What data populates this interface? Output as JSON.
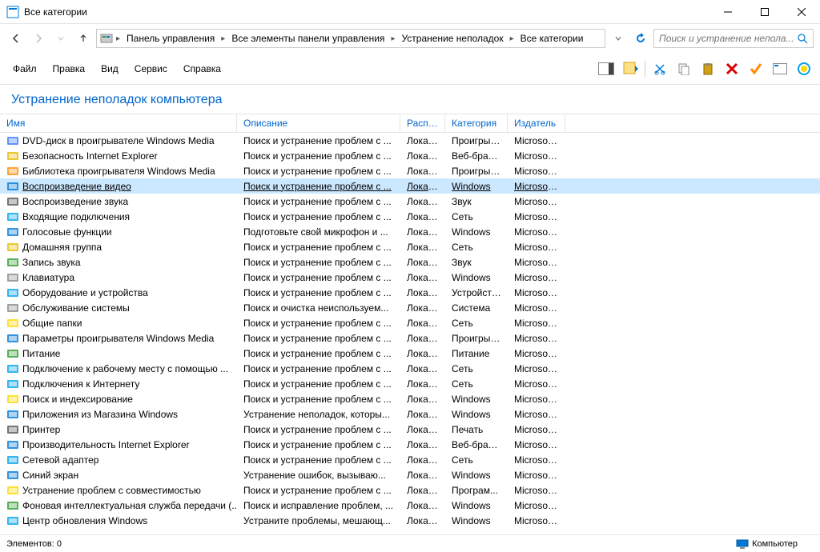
{
  "window": {
    "title": "Все категории",
    "minimize": "—",
    "maximize": "☐",
    "close": "✕"
  },
  "breadcrumb": {
    "items": [
      "Панель управления",
      "Все элементы панели управления",
      "Устранение неполадок",
      "Все категории"
    ]
  },
  "search": {
    "placeholder": "Поиск и устранение непола..."
  },
  "menu": {
    "items": [
      "Файл",
      "Правка",
      "Вид",
      "Сервис",
      "Справка"
    ]
  },
  "heading": "Устранение неполадок компьютера",
  "columns": {
    "name": "Имя",
    "desc": "Описание",
    "loc": "Распо...",
    "cat": "Категория",
    "pub": "Издатель"
  },
  "rows": [
    {
      "name": "DVD-диск в проигрывателе Windows Media",
      "desc": "Поиск и устранение проблем с ...",
      "loc": "Локал...",
      "cat": "Проигрыв...",
      "pub": "Microsoft ...",
      "icon": "#3b78ff"
    },
    {
      "name": "Безопасность Internet Explorer",
      "desc": "Поиск и устранение проблем с ...",
      "loc": "Локал...",
      "cat": "Веб-брауз...",
      "pub": "Microsoft ...",
      "icon": "#e7b900"
    },
    {
      "name": "Библиотека проигрывателя Windows Media",
      "desc": "Поиск и устранение проблем с ...",
      "loc": "Локал...",
      "cat": "Проигрыв...",
      "pub": "Microsoft ...",
      "icon": "#ff8c00"
    },
    {
      "name": "Воспроизведение видео",
      "desc": "Поиск и устранение проблем с ...",
      "loc": "Локал...",
      "cat": "Windows",
      "pub": "Microsoft ...",
      "icon": "#0078d7",
      "selected": true
    },
    {
      "name": "Воспроизведение звука",
      "desc": "Поиск и устранение проблем с ...",
      "loc": "Локал...",
      "cat": "Звук",
      "pub": "Microsoft ...",
      "icon": "#555"
    },
    {
      "name": "Входящие подключения",
      "desc": "Поиск и устранение проблем с ...",
      "loc": "Локал...",
      "cat": "Сеть",
      "pub": "Microsoft ...",
      "icon": "#00a2ed"
    },
    {
      "name": "Голосовые функции",
      "desc": "Подготовьте свой микрофон и ...",
      "loc": "Локал...",
      "cat": "Windows",
      "pub": "Microsoft ...",
      "icon": "#0078d7"
    },
    {
      "name": "Домашняя группа",
      "desc": "Поиск и устранение проблем с ...",
      "loc": "Локал...",
      "cat": "Сеть",
      "pub": "Microsoft ...",
      "icon": "#e7b900"
    },
    {
      "name": "Запись звука",
      "desc": "Поиск и устранение проблем с ...",
      "loc": "Локал...",
      "cat": "Звук",
      "pub": "Microsoft ...",
      "icon": "#2e9b2e"
    },
    {
      "name": "Клавиатура",
      "desc": "Поиск и устранение проблем с ...",
      "loc": "Локал...",
      "cat": "Windows",
      "pub": "Microsoft ...",
      "icon": "#888"
    },
    {
      "name": "Оборудование и устройства",
      "desc": "Поиск и устранение проблем с ...",
      "loc": "Локал...",
      "cat": "Устройство",
      "pub": "Microsoft ...",
      "icon": "#00a2ed"
    },
    {
      "name": "Обслуживание системы",
      "desc": "Поиск и очистка неиспользуем...",
      "loc": "Локал...",
      "cat": "Система",
      "pub": "Microsoft ...",
      "icon": "#888"
    },
    {
      "name": "Общие папки",
      "desc": "Поиск и устранение проблем с ...",
      "loc": "Локал...",
      "cat": "Сеть",
      "pub": "Microsoft ...",
      "icon": "#ffd700"
    },
    {
      "name": "Параметры проигрывателя Windows Media",
      "desc": "Поиск и устранение проблем с ...",
      "loc": "Локал...",
      "cat": "Проигрыв...",
      "pub": "Microsoft ...",
      "icon": "#0078d7"
    },
    {
      "name": "Питание",
      "desc": "Поиск и устранение проблем с ...",
      "loc": "Локал...",
      "cat": "Питание",
      "pub": "Microsoft ...",
      "icon": "#2e9b2e"
    },
    {
      "name": "Подключение к рабочему месту с помощью ...",
      "desc": "Поиск и устранение проблем с ...",
      "loc": "Локал...",
      "cat": "Сеть",
      "pub": "Microsoft ...",
      "icon": "#00a2ed"
    },
    {
      "name": "Подключения к Интернету",
      "desc": "Поиск и устранение проблем с ...",
      "loc": "Локал...",
      "cat": "Сеть",
      "pub": "Microsoft ...",
      "icon": "#00a2ed"
    },
    {
      "name": "Поиск и индексирование",
      "desc": "Поиск и устранение проблем с ...",
      "loc": "Локал...",
      "cat": "Windows",
      "pub": "Microsoft ...",
      "icon": "#ffd700"
    },
    {
      "name": "Приложения из Магазина Windows",
      "desc": "Устранение неполадок, которы...",
      "loc": "Локал...",
      "cat": "Windows",
      "pub": "Microsoft ...",
      "icon": "#0078d7"
    },
    {
      "name": "Принтер",
      "desc": "Поиск и устранение проблем с ...",
      "loc": "Локал...",
      "cat": "Печать",
      "pub": "Microsoft ...",
      "icon": "#555"
    },
    {
      "name": "Производительность Internet Explorer",
      "desc": "Поиск и устранение проблем с ...",
      "loc": "Локал...",
      "cat": "Веб-брауз...",
      "pub": "Microsoft ...",
      "icon": "#0078d7"
    },
    {
      "name": "Сетевой адаптер",
      "desc": "Поиск и устранение проблем с ...",
      "loc": "Локал...",
      "cat": "Сеть",
      "pub": "Microsoft ...",
      "icon": "#00a2ed"
    },
    {
      "name": "Синий экран",
      "desc": "Устранение ошибок, вызываю...",
      "loc": "Локал...",
      "cat": "Windows",
      "pub": "Microsoft ...",
      "icon": "#0078d7"
    },
    {
      "name": "Устранение проблем с совместимостью",
      "desc": "Поиск и устранение проблем с ...",
      "loc": "Локал...",
      "cat": "Програм...",
      "pub": "Microsoft ...",
      "icon": "#ffd700"
    },
    {
      "name": "Фоновая интеллектуальная служба передачи (...",
      "desc": "Поиск и исправление проблем, ...",
      "loc": "Локал...",
      "cat": "Windows",
      "pub": "Microsoft ...",
      "icon": "#2e9b2e"
    },
    {
      "name": "Центр обновления Windows",
      "desc": "Устраните проблемы, мешающ...",
      "loc": "Локал...",
      "cat": "Windows",
      "pub": "Microsoft ...",
      "icon": "#00a2ed"
    }
  ],
  "status": {
    "left": "Элементов: 0",
    "right": "Компьютер"
  }
}
